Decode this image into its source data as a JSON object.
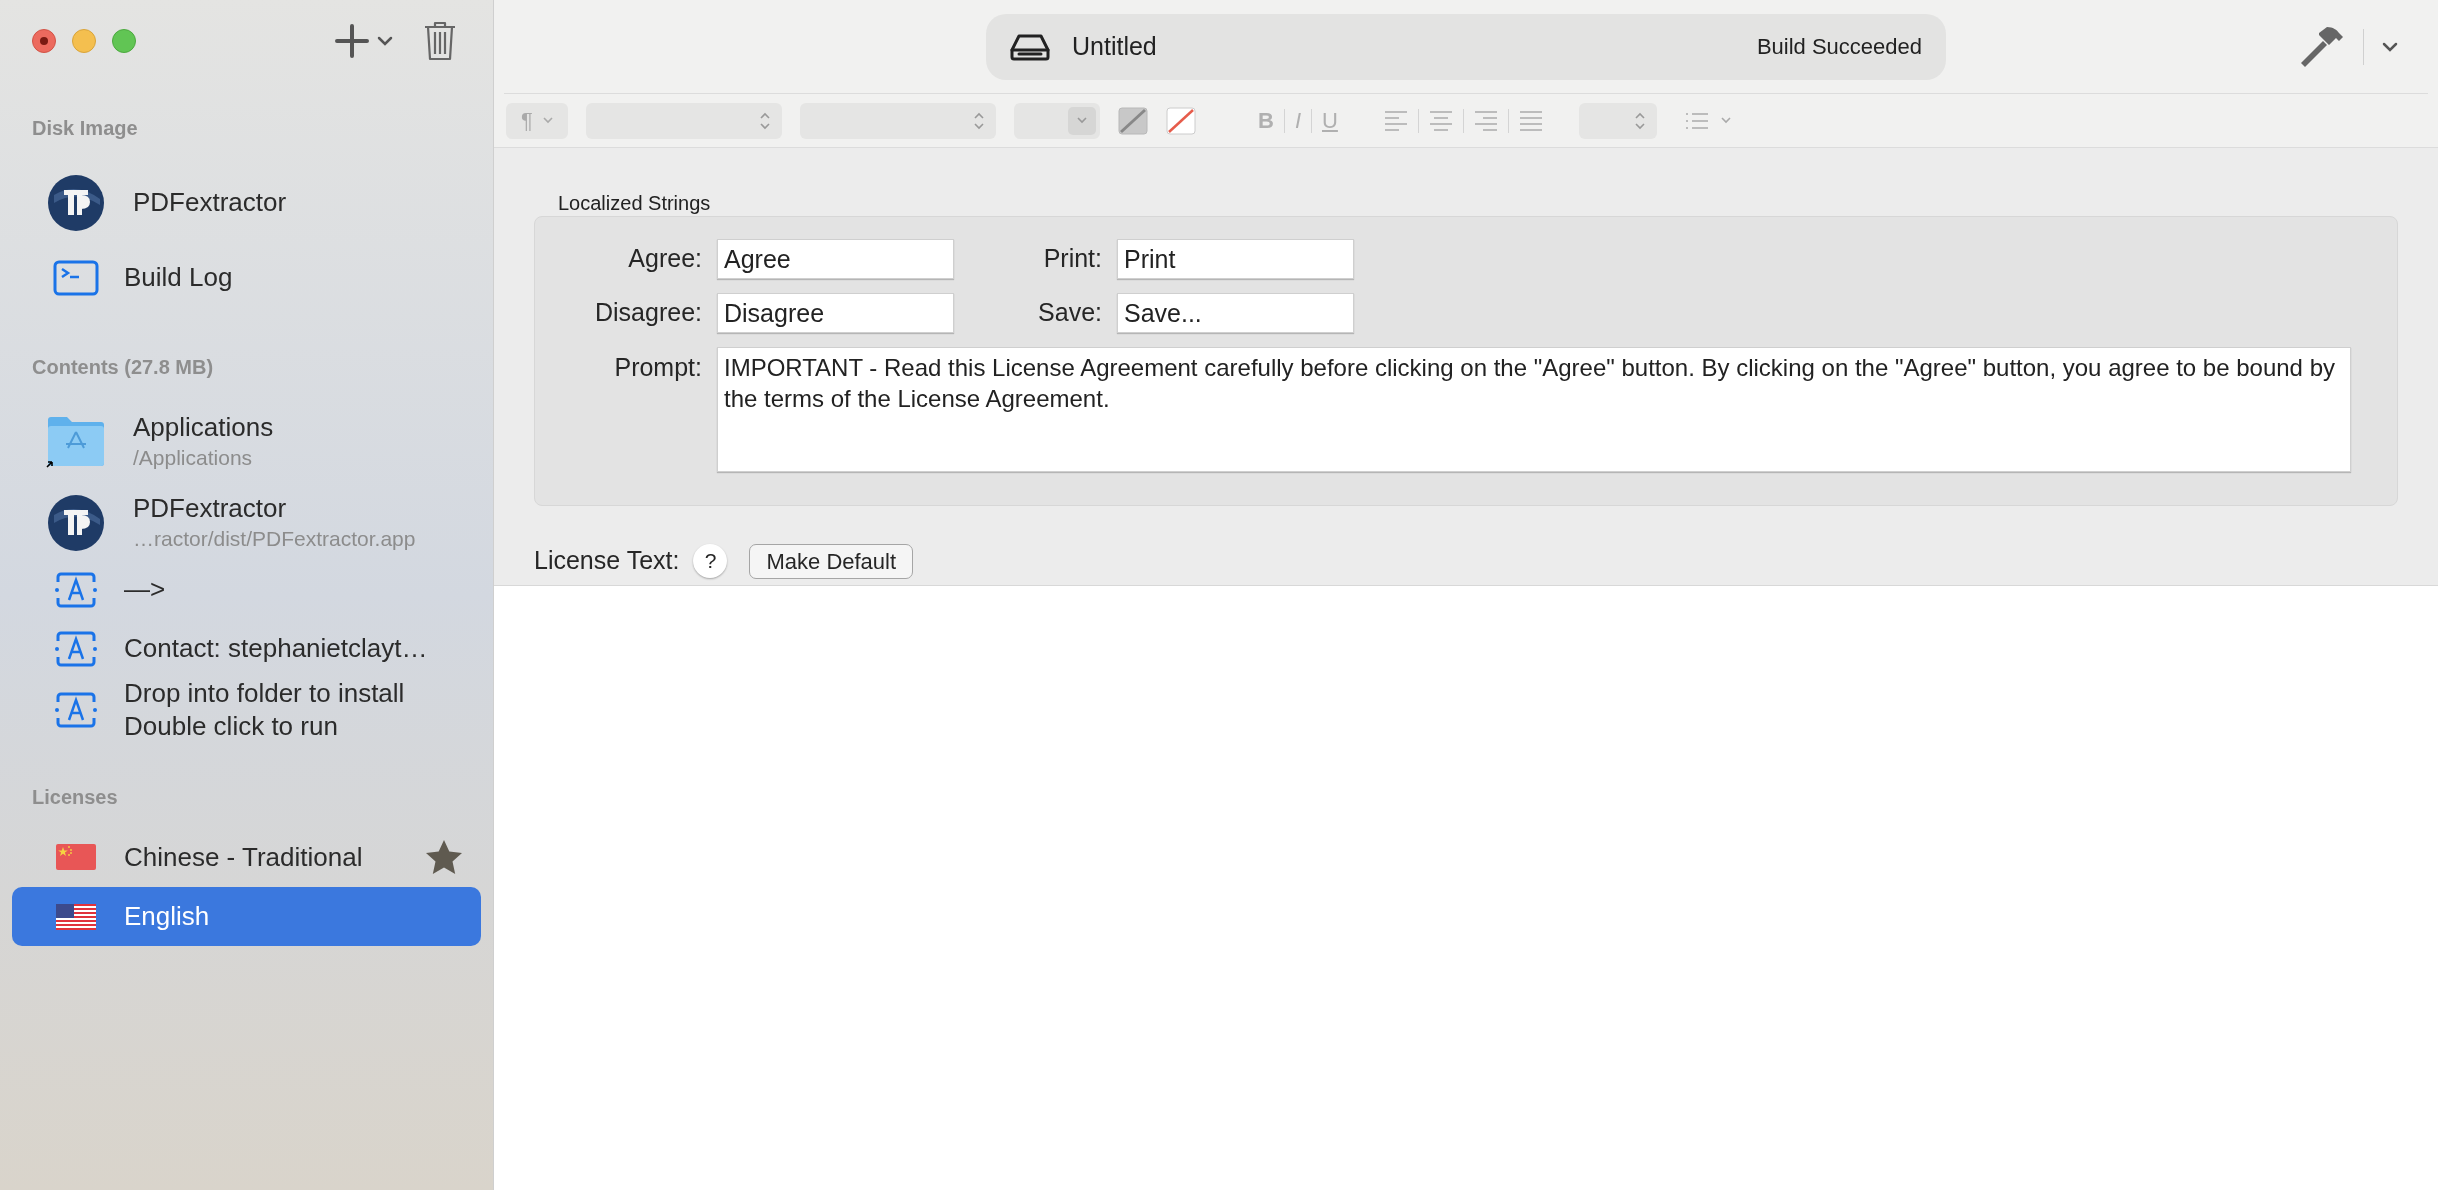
{
  "window": {
    "title": "Untitled",
    "status": "Build Succeeded"
  },
  "sidebar": {
    "sections": [
      {
        "header": "Disk Image",
        "items": [
          {
            "kind": "app",
            "label": "PDFextractor",
            "selected": false
          },
          {
            "kind": "log",
            "label": "Build Log",
            "selected": false
          }
        ]
      },
      {
        "header": "Contents (27.8 MB)",
        "items": [
          {
            "kind": "folder",
            "label": "Applications",
            "subtitle": "/Applications",
            "selected": false
          },
          {
            "kind": "app",
            "label": "PDFextractor",
            "subtitle": "…ractor/dist/PDFextractor.app",
            "selected": false
          },
          {
            "kind": "text",
            "label": "—>",
            "selected": false
          },
          {
            "kind": "text",
            "label": "Contact: stephanietclayt…",
            "selected": false
          },
          {
            "kind": "text",
            "label": "Drop into folder to install\nDouble click to run",
            "selected": false
          }
        ]
      },
      {
        "header": "Licenses",
        "items": [
          {
            "kind": "flag-cn",
            "label": "Chinese - Traditional",
            "default": true,
            "selected": false
          },
          {
            "kind": "flag-us",
            "label": "English",
            "default": false,
            "selected": true
          }
        ]
      }
    ]
  },
  "format_bar": {
    "paragraph": "¶",
    "bold": "B",
    "italic": "I",
    "underline": "U"
  },
  "localized_strings": {
    "title": "Localized Strings",
    "fields": [
      {
        "label": "Agree:",
        "value": "Agree"
      },
      {
        "label": "Print:",
        "value": "Print"
      },
      {
        "label": "Disagree:",
        "value": "Disagree"
      },
      {
        "label": "Save:",
        "value": "Save..."
      }
    ],
    "prompt": {
      "label": "Prompt:",
      "value": "IMPORTANT - Read this License Agreement carefully before clicking on the \"Agree\" button. By clicking on the \"Agree\" button, you agree to be bound by the terms of the License Agreement."
    }
  },
  "license_text": {
    "label": "License Text:",
    "help": "?",
    "button": "Make Default"
  }
}
